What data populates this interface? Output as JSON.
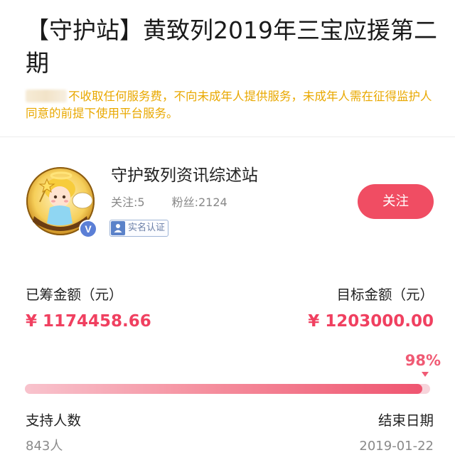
{
  "campaign": {
    "title": "【守护站】黄致列2019年三宝应援第二期"
  },
  "notice": {
    "text": "不收取任何服务费，不向未成年人提供服务，未成年人需在征得监护人同意的前提下使用平台服务。"
  },
  "station": {
    "name": "守护致列资讯综述站",
    "follow_label": "关注:5",
    "fans_label": "粉丝:2124",
    "verified_badge": "V",
    "verify_text": "实名认证",
    "follow_button": "关注",
    "avatar_icon": "angel-avatar-icon"
  },
  "funding": {
    "raised_label": "已筹金额（元）",
    "raised_amount": "¥ 1174458.66",
    "target_label": "目标金额（元）",
    "target_amount": "¥ 1203000.00",
    "percent_text": "98%",
    "progress_fraction": 0.98
  },
  "footer": {
    "supporters_label": "支持人数",
    "supporters_value": "843人",
    "end_label": "结束日期",
    "end_value": "2019-01-22"
  },
  "colors": {
    "accent": "#f04d63",
    "notice": "#e9a800",
    "amount": "#f04060"
  }
}
